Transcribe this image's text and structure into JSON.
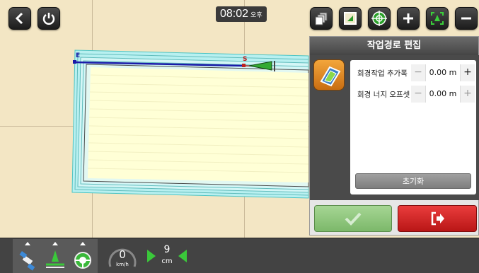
{
  "top_bar": {
    "back_icon": "chevron-left-icon",
    "power_icon": "power-icon",
    "clock_time": "08:02",
    "clock_ampm": "오후",
    "right_icons": [
      "layers-icon",
      "map-view-icon",
      "target-icon",
      "zoom-in-icon",
      "fit-view-icon",
      "zoom-out-icon"
    ]
  },
  "map": {
    "start_label": "S",
    "end_label": "E"
  },
  "panel": {
    "title": "작업경로 편집",
    "headland_width": {
      "label": "회경작업 추가폭",
      "minus": "−",
      "value": "0.00 m",
      "plus": "+"
    },
    "headland_offset": {
      "label": "회경 너지 오프셋",
      "minus": "−",
      "value": "0.00 m",
      "plus": "+"
    },
    "reset_label": "초기화"
  },
  "bottom_bar": {
    "speed_value": "0",
    "speed_unit": "km/h",
    "lightbar_value": "9",
    "lightbar_unit": "cm"
  },
  "colors": {
    "field_fill": "#ffffd8",
    "boundary": "#8fe6e8",
    "guide_line": "#1a1aa8",
    "ok_green": "#8cc878",
    "exit_red": "#d42424"
  }
}
